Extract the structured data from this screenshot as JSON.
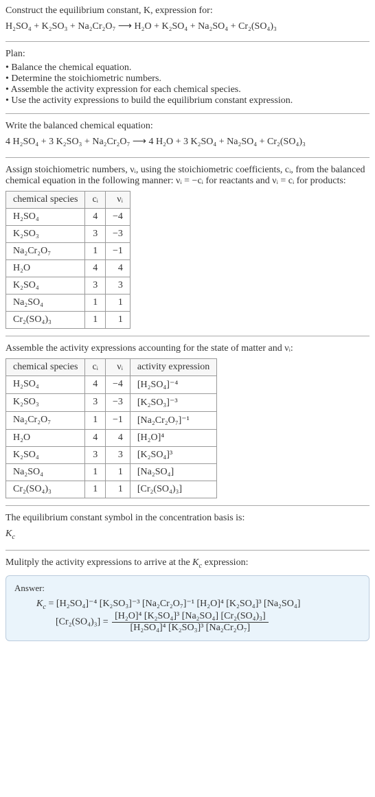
{
  "intro": {
    "line1": "Construct the equilibrium constant, K, expression for:",
    "eq": "H₂SO₄ + K₂SO₃ + Na₂Cr₂O₇ ⟶ H₂O + K₂SO₄ + Na₂SO₄ + Cr₂(SO₄)₃"
  },
  "plan": {
    "heading": "Plan:",
    "items": [
      "Balance the chemical equation.",
      "Determine the stoichiometric numbers.",
      "Assemble the activity expression for each chemical species.",
      "Use the activity expressions to build the equilibrium constant expression."
    ]
  },
  "balance": {
    "heading": "Write the balanced chemical equation:",
    "eq": "4 H₂SO₄ + 3 K₂SO₃ + Na₂Cr₂O₇ ⟶ 4 H₂O + 3 K₂SO₄ + Na₂SO₄ + Cr₂(SO₄)₃"
  },
  "stoich": {
    "intro": "Assign stoichiometric numbers, νᵢ, using the stoichiometric coefficients, cᵢ, from the balanced chemical equation in the following manner: νᵢ = −cᵢ for reactants and νᵢ = cᵢ for products:",
    "headers": {
      "species": "chemical species",
      "ci": "cᵢ",
      "vi": "νᵢ"
    },
    "rows": [
      {
        "species": "H₂SO₄",
        "ci": "4",
        "vi": "−4"
      },
      {
        "species": "K₂SO₃",
        "ci": "3",
        "vi": "−3"
      },
      {
        "species": "Na₂Cr₂O₇",
        "ci": "1",
        "vi": "−1"
      },
      {
        "species": "H₂O",
        "ci": "4",
        "vi": "4"
      },
      {
        "species": "K₂SO₄",
        "ci": "3",
        "vi": "3"
      },
      {
        "species": "Na₂SO₄",
        "ci": "1",
        "vi": "1"
      },
      {
        "species": "Cr₂(SO₄)₃",
        "ci": "1",
        "vi": "1"
      }
    ]
  },
  "activity": {
    "intro": "Assemble the activity expressions accounting for the state of matter and νᵢ:",
    "headers": {
      "species": "chemical species",
      "ci": "cᵢ",
      "vi": "νᵢ",
      "act": "activity expression"
    },
    "rows": [
      {
        "species": "H₂SO₄",
        "ci": "4",
        "vi": "−4",
        "act": "[H₂SO₄]⁻⁴"
      },
      {
        "species": "K₂SO₃",
        "ci": "3",
        "vi": "−3",
        "act": "[K₂SO₃]⁻³"
      },
      {
        "species": "Na₂Cr₂O₇",
        "ci": "1",
        "vi": "−1",
        "act": "[Na₂Cr₂O₇]⁻¹"
      },
      {
        "species": "H₂O",
        "ci": "4",
        "vi": "4",
        "act": "[H₂O]⁴"
      },
      {
        "species": "K₂SO₄",
        "ci": "3",
        "vi": "3",
        "act": "[K₂SO₄]³"
      },
      {
        "species": "Na₂SO₄",
        "ci": "1",
        "vi": "1",
        "act": "[Na₂SO₄]"
      },
      {
        "species": "Cr₂(SO₄)₃",
        "ci": "1",
        "vi": "1",
        "act": "[Cr₂(SO₄)₃]"
      }
    ]
  },
  "symbol": {
    "line1": "The equilibrium constant symbol in the concentration basis is:",
    "sym": "K_c"
  },
  "final": {
    "intro": "Mulitply the activity expressions to arrive at the K_c expression:",
    "answer_label": "Answer:",
    "line1_prefix": "K_c = ",
    "line1_terms": "[H₂SO₄]⁻⁴ [K₂SO₃]⁻³ [Na₂Cr₂O₇]⁻¹ [H₂O]⁴ [K₂SO₄]³ [Na₂SO₄]",
    "line2_prefix": "[Cr₂(SO₄)₃] = ",
    "frac_num": "[H₂O]⁴ [K₂SO₄]³ [Na₂SO₄] [Cr₂(SO₄)₃]",
    "frac_den": "[H₂SO₄]⁴ [K₂SO₃]³ [Na₂Cr₂O₇]"
  }
}
